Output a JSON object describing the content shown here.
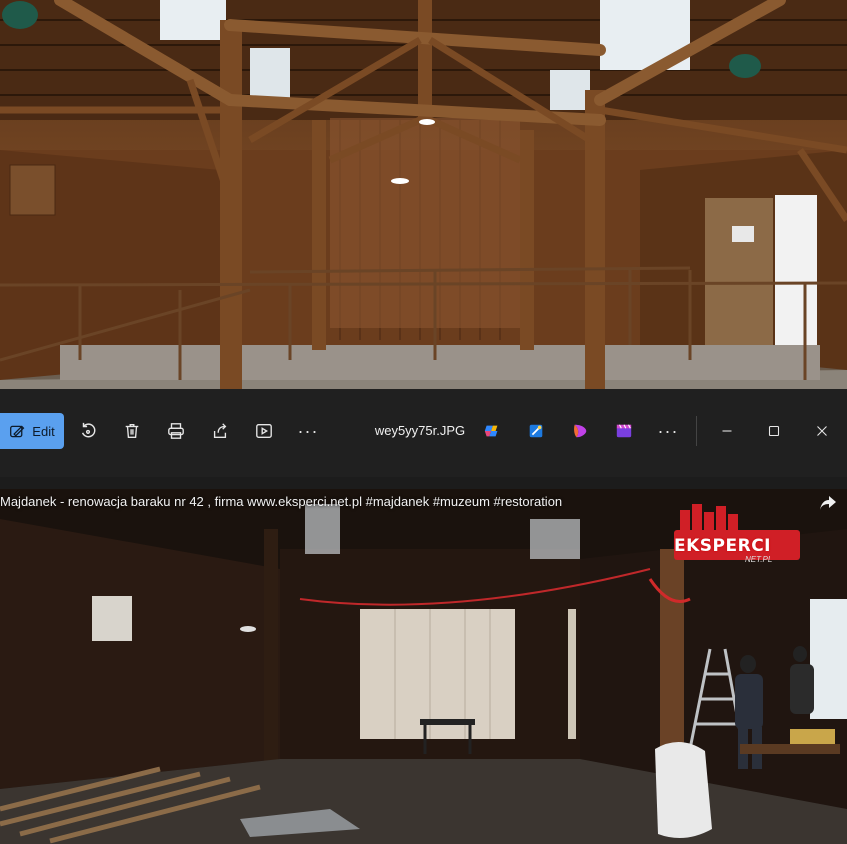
{
  "toolbar": {
    "edit_label": "Edit",
    "filename": "wey5yy75r.JPG",
    "more_label": "···",
    "more2_label": "···",
    "icons": [
      "edit-image-icon",
      "rotate-icon",
      "delete-icon",
      "print-icon",
      "share-icon",
      "slideshow-icon",
      "more-icon",
      "copilot-icon",
      "designer-icon",
      "clipchamp-icon",
      "video-editor-icon",
      "more-apps-icon",
      "minimize-icon",
      "maximize-icon",
      "close-icon"
    ],
    "accent_color": "#5aa0ef"
  },
  "video": {
    "title": "Majdanek - renowacja baraku nr 42 , firma www.eksperci.net.pl #majdanek #muzeum #restoration",
    "logo_text": "EKSPERCI",
    "logo_sub": "NET.PL"
  }
}
